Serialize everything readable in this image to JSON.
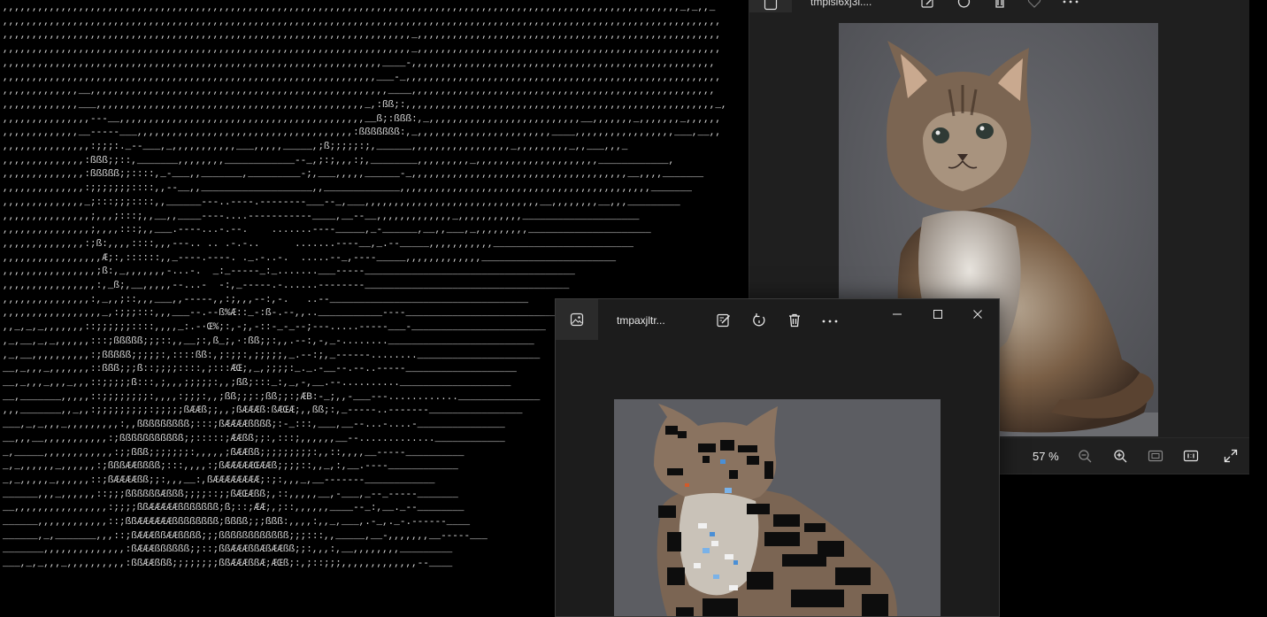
{
  "ascii_art": {
    "lines": [
      ",,,,,,,,,,,,,,,,,,,,,,,,,,,,,,,,,,,,,,,,,,,,,,,,,,,,,,,,,,,,,,,,,,,,,,,,,,,,,,,,,,,,,,,,,,,,,,,,,,,,,,,,,,,,,,,,,,,,_,_,,_",
      ",,,,,,,,,,,,,,,,,,,,,,,,,,,,,,,,,,,,,,,,,,,,,,,,,,,,,,,,,,,,,,,,,,,,,,,,,,,,,,,,,,,,,,,,,,,,,,,,,,,,,,,,,,,,,,,,,,,,,,,,,,,",
      ",,,,,,,,,,,,,,,,,,,,,,,,,,,,,,,,,,,,,,,,,,,,,,,,,,,,,,,,,,,,,,,,,,,,,,_,,,,,,,,,,,,,,,,,,,,,,,,,,,,,,,,,,,,,,,,,,,,,,,,,,,,",
      ",,,,,,,,,,,,,,,,,,,,,,,,,,,,,,,,,,,,,,,,,,,,,,,,,,,,,,,,,,,,,,,,,,,,,,_,,,,,,,,,,,,,,,,,,,,,,,,,,,,,,,,,,,,,,,,,,,,,,,,,,,,",
      ",,,,,,,,,,,,,,,,,,,,,,,,,,,,,,,,,,,,,,,,,,,,,,,,,,,,,,,,,,,,,,,,,____-,,,,,,,,,,,,,,,,,,,,,,,,,,,,,,,,,,,,,,,,,,,,,,,,,,,,",
      ",,,,,,,,,,,,,,,,,,,,,,,,,,,,,,,,,,,,,,,,,,,,,,,,,,,,,,,,,,,,,,,,___-_,,,,,,,,,,,,,,,,,,,,,,,,,,,,,,,,,,,,,,,,,,,,,,,,,,,,,,",
      ",,,,,,,,,,,,,__,,,,,,,,,,,,,,,,,,,,,,,,,,,,,,,,,,,,,,,,,,,,,,,,,,,____,,,,,,,,,,,,,,,,,,,,,,,,,,,,,,,,,,,,,,,,,,,,,,,,,,,,",
      ",,,,,,,,,,,,,___,,,,,,,,,,,,,,,,,,,,,,,,,,,,,,,,,,,,,,,,,,,,,,_,:ßß;:,,,,,,,,,,,,,,,,,,,,,,,,,,,,,,,,,,,,,,,,,,,,,,,,,,,,,_,",
      ",,,,,,,,,,,,,,,---__,,,,,,,,,,,,,,,,,,,,,,,,,,,,,,,,,,,,,,,,,,__ß;:ßßß:,_,,,,,,,,,,,,,,,,,,,,,,,,,,__,,,,,,,_,,,,,,,_,,,,,,",
      ",,,,,,,,,,,,,__-----___,,,,,,,,,,,,,,,,,,,,,,,,,,,,,,,,,,,,,:ßßßßßßß:,_,,,,,,,,,,,,,,,,,,,,,,,____,,,,,,,,,,,,,,,,,___,__,,",
      ",,,,,,,,,,,,,,,:;;;:._--___,_,,,,,,,,,,,___,,,,,_____,;ß;;;;;:;,______,,,,,,,,,,,,,,,,,_,,,,,,,,,_,,___,,,_",
      ",,,,,,,,,,,,,,:ßßß;;::,_______,,,,,,,,____________--_,;:;,,,:;,________,,,,,,,,,_,,,,,,,,,,,,,,,,,,,,,____________,",
      ",,,,,,,,,,,,,,:ßßßßß;;::::,_-___,,_______,_________-;,___,,,,,______-_,,,,,,,,,,,,,,,,,,,,,,,,,,,,,,,,,,,,,__,,,,_______",
      ",,,,,,,,,,,,,,:;;;;;;;::::,,--__,,___________________,,_____________,,,,,,,,,,,,,,,,,,,,,,,,,,,,,,,,,,,,,,,,,,,_______",
      ",,,,,,,,,,,,,,_;:::;;;::::,,______---..----.--------___--_,___,,,,,,,,,,,,,,,,,,,,,,,,,,,,,,__,,,,,,,,__,,,_________",
      ",,,,,,,,,,,,,,,;,,,;:::;,,__,,____----....-----------____,__--__,,,,,,,,,,,,,_,,,,,,,,,,,____________________",
      ",,,,,,,,,,,,,,,;,,,,:::;,,___.----...-.--.    .......----_____,_-______,__,,___,_,,,,,,,,,_____________________",
      ",,,,,,,,,,,,,,:;ß:,,,,::::,,,---.. .. .-.-..      .......----__,_.--_____,,,,,,,,,,,________________________",
      ",,,,,,,,,,,,,,,,,Æ;:,::::::,,_----.----. ._.-..-.  .....--_,----_____,,,,,,,,,,,,,_______________________",
      ",,,,,,,,,,,,,,,,;ß:,_,,,,,,,-...-.  _:_-----_:_.......___-----____________________________________",
      ",,,,,,,,,,,,,,,,:,_ß;,__,,,,,--...-  -:,_-----.-......--------___________________________________",
      ",,,,,,,,,,,,,,,:,_,,;::,,,___,,-----,,:;,,,--:,-.   ..--__________________________________",
      ",,,,,,,,,,,,,,,,,_,:;;;:::,,,___--.--ß%Æ::_-:ß-.--,,..___________----___________________________",
      ",,_,_,_,,,,,,,::;;;;;;::::,,,,_:.-·Œ%;:,-;,-::-_-_--;---.....-----___-_______________________",
      ",_,__,_,_,,,,,,:::;ßßßßß;;;::,,__;:,ß_;,·:ßß;;:,,.--:,-,_-........_________________________",
      ",_,__,,,,,,,,,,:;ßßßßß;;;;;:,::::ßß:,;:;;:,;;;;;,_.--:;,_------........_____________________",
      "__,_,,,_,,,,,,,::ßßß;;;ß::;;;;::::,;:::ÆŒ;,_,;;;;:_._.-__--.--..-----___________________",
      "__,_,,,_,,,_,,,::;;;;;ß:::,;,,,;;;;;:,,;ßß;:::_:,_,-,__.--..........___________________",
      "__,_______,,,,,::;;;;;;;;:,,,,:;;;:,,;ßß;;;:;ßß;;:;ÆB:-_;,,-___---............______________",
      ",,,_______,,_,,:;;;;;;;;;:;;;;;ßÆÆß;;,,;ßÆÆÆß:ßÆŒÆ;,,ßß;:,_-----..-------________________",
      "___,_,_,,,_,,,,,,,,,:,,ßßßßßßßßß;:::;ßÆÆÆÆßßßß;:-_:::,___,__--...-....-_______________",
      "__,,,__,,,,,,,,,,,:;ßßßßßßßßßßß;;:::::;ÆÆßß;;:,:::;,,,,,,__--.............____________",
      "_,_____,,,,,,,,,,,,:;;ßßß;;;;;;;:,,,,,;ßÆÆßß;;;;;;;;;:,,::,,,,__-----__________",
      "_,_,,,,,,_,,,,,,:;ßßßÆÆßßßß;:::,,,,:;ßÆÆÆÆÆŒÆÆß;;;;::,,_,:,__.----____________",
      "_,_,,,,,_,,,,,,::;ßÆÆÆÆßß;;:,,,__:,ßÆÆÆÆÆÆÆÆ;:;:,,,_,__-------____________",
      "______,,,_,,,,,,::;;;ßßßßßßÆßßß;;;;::;;ßÆŒÆßß;,::,,,,,__,-___,_--_-----_______",
      "__,,,,,,,,,,,,,,,,:;;;;ßßÆÆÆÆÆßßßßßßß;ß;::;ÆÆ;,;::,,,,,,____--_:,__._--________",
      "______,,,,,,,,,,,,::;ßßÆÆÆÆÆÆßßßßßßßß;ßßßß;;;ßßß:,,,,:,,_,___,.-_,._-.------____",
      "______,_,_______,,,::;ßÆÆÆßßÆÆßßßß;;;ßßßßßßßßßßßß;;;:::,,_____,__-,,,,,,,__-----___",
      "_______,,,,,,,,,,,,,,:ßÆÆÆßßßßßß;;::;ßßÆÆÆßßÆßÆÆßß;;:,,,:,__,,,,,,,,_________",
      "___,_,_,,,_,,,,,,,,,,:ßßÆÆßßß;;;;;;;;ßßÆÆÆßßÆ;ÆŒß;:,;::;;;,,,,,,,,,,,,,--____"
    ]
  },
  "back_window": {
    "filename": "tmpisi6xj3l....",
    "zoom_text": "57 %",
    "icons": [
      "image-icon",
      "edit-icon",
      "rotate-icon",
      "delete-icon",
      "heart-icon",
      "more-icon"
    ],
    "statusbar_icons": [
      "zoom-out-icon",
      "zoom-in-icon",
      "fit-icon",
      "actual-size-icon",
      "fullscreen-icon"
    ]
  },
  "front_window": {
    "filename": "tmpaxjltr...",
    "icons": [
      "image-icon",
      "edit-icon",
      "rotate-icon",
      "delete-icon",
      "more-icon",
      "minimize-icon",
      "maximize-icon",
      "close-icon"
    ]
  },
  "colors": {
    "window_bg": "#1f1f1f",
    "titlebar_bg": "#1c1c1c",
    "photo_bg": "#5e5f63",
    "text": "#e6e6e6"
  }
}
